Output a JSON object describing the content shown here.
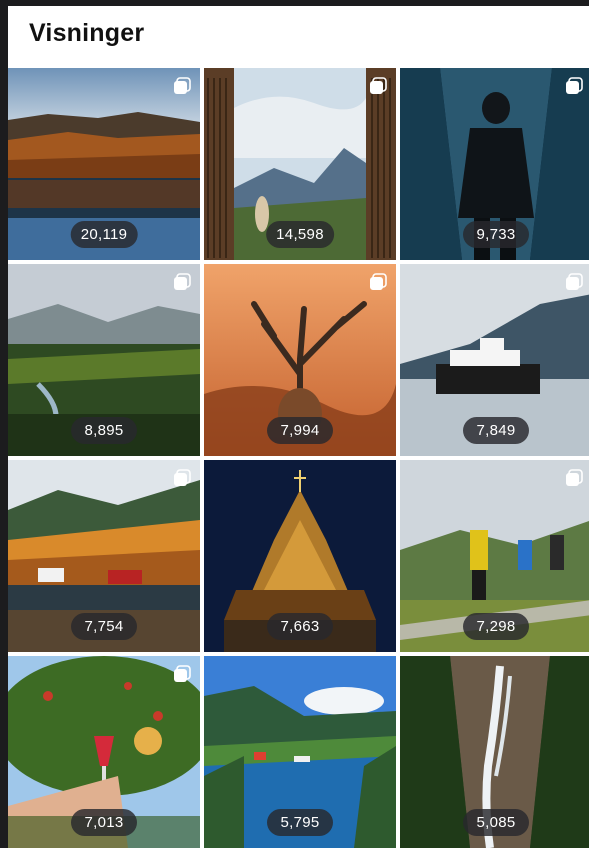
{
  "header": {
    "title": "Visninger"
  },
  "tiles": [
    {
      "count": "20,119",
      "icon": "multi-photo-icon"
    },
    {
      "count": "14,598",
      "icon": "multi-photo-icon"
    },
    {
      "count": "9,733",
      "icon": "multi-photo-icon"
    },
    {
      "count": "8,895",
      "icon": "multi-photo-icon"
    },
    {
      "count": "7,994",
      "icon": "multi-photo-icon"
    },
    {
      "count": "7,849",
      "icon": "multi-photo-icon"
    },
    {
      "count": "7,754",
      "icon": "multi-photo-icon"
    },
    {
      "count": "7,663",
      "icon": "none"
    },
    {
      "count": "7,298",
      "icon": "multi-photo-icon"
    },
    {
      "count": "7,013",
      "icon": "multi-photo-icon"
    },
    {
      "count": "5,795",
      "icon": "none"
    },
    {
      "count": "5,085",
      "icon": "none"
    }
  ]
}
